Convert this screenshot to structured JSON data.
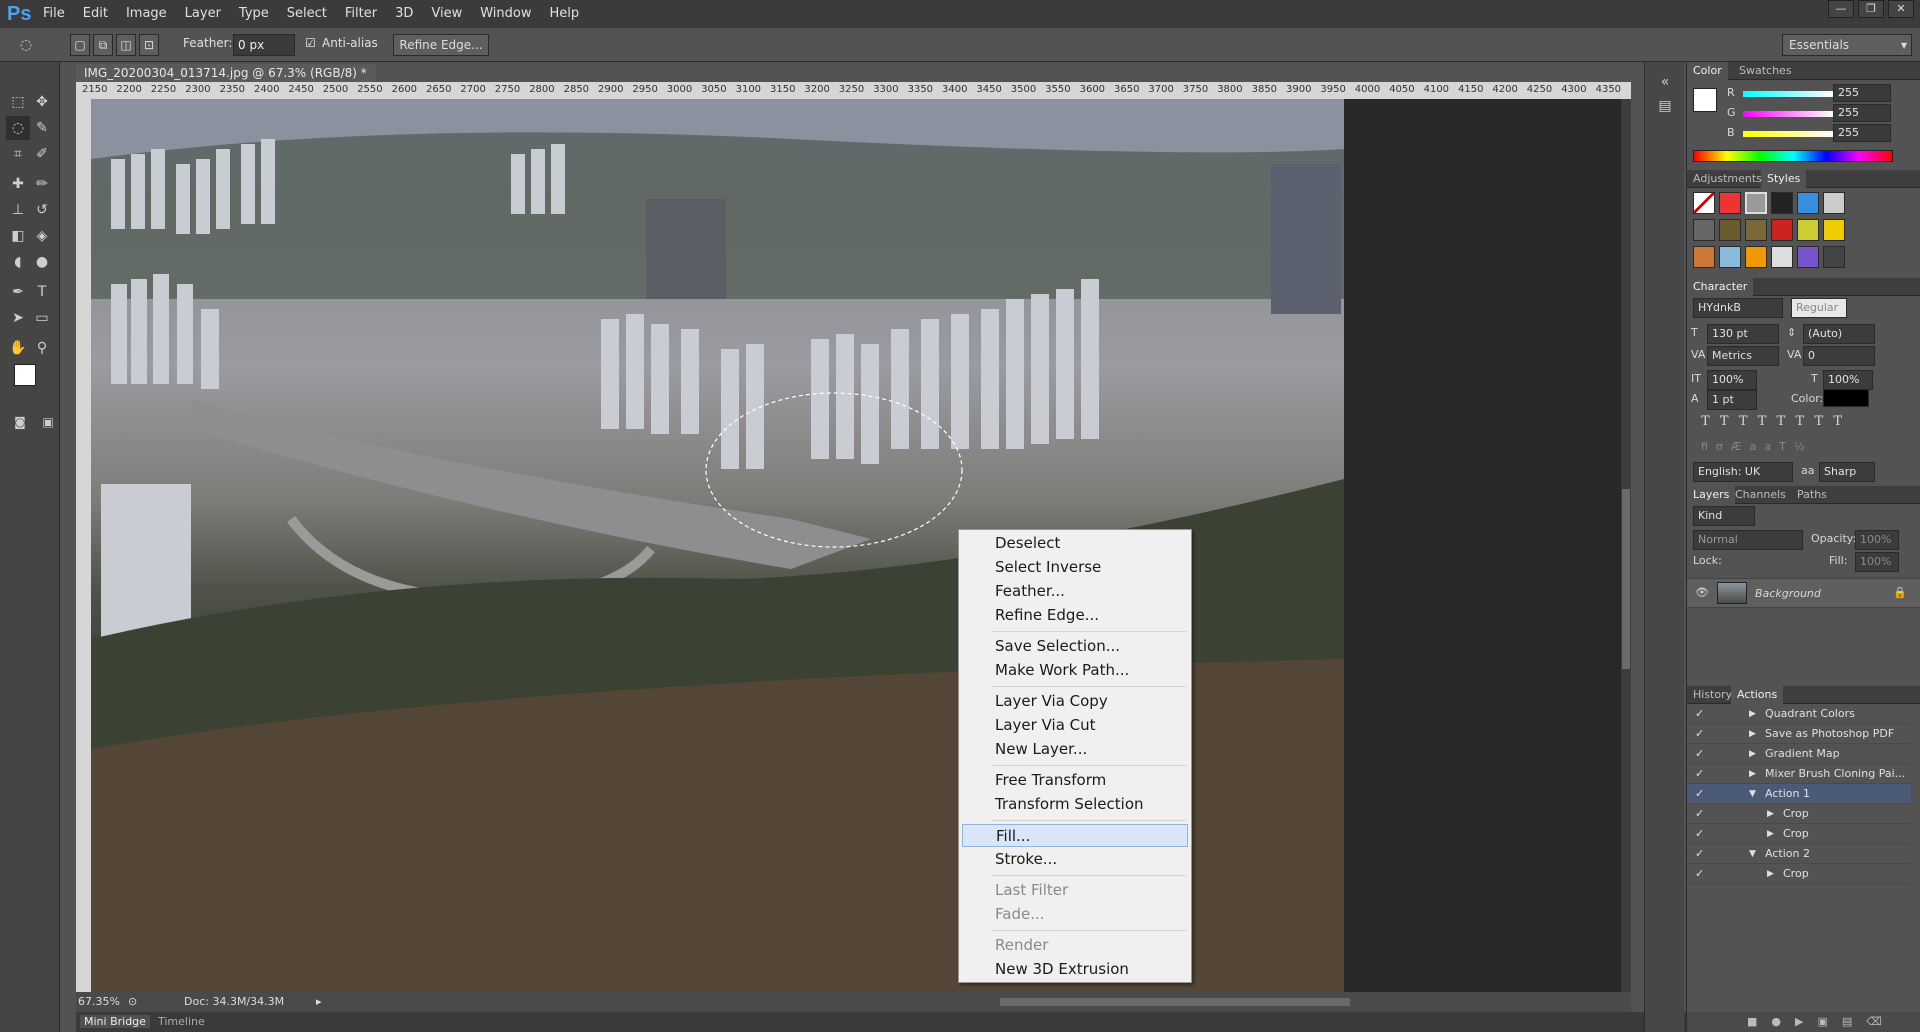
{
  "app": {
    "logo": "Ps"
  },
  "menubar": {
    "items": [
      "File",
      "Edit",
      "Image",
      "Layer",
      "Type",
      "Select",
      "Filter",
      "3D",
      "View",
      "Window",
      "Help"
    ]
  },
  "window_controls": {
    "minimize": "—",
    "restore": "❐",
    "close": "✕"
  },
  "options": {
    "feather_label": "Feather:",
    "feather_value": "0 px",
    "antialias_label": "Anti-alias",
    "antialias_checked": true,
    "refine_edge": "Refine Edge...",
    "workspace": "Essentials"
  },
  "document": {
    "tab_title": "IMG_20200304_013714.jpg @ 67.3% (RGB/8) *",
    "close": "×",
    "ruler_ticks": [
      "2150",
      "2200",
      "2250",
      "2300",
      "2350",
      "2400",
      "2450",
      "2500",
      "2550",
      "2600",
      "2650",
      "2700",
      "2750",
      "2800",
      "2850",
      "2900",
      "2950",
      "3000",
      "3050",
      "3100",
      "3150",
      "3200",
      "3250",
      "3300",
      "3350",
      "3400",
      "3450",
      "3500",
      "3550",
      "3600",
      "3650",
      "3700",
      "3750",
      "3800",
      "3850",
      "3900",
      "3950",
      "4000",
      "4050",
      "4100",
      "4150",
      "4200",
      "4250",
      "4300",
      "4350"
    ]
  },
  "status": {
    "zoom": "67.35%",
    "doc": "Doc: 34.3M/34.3M"
  },
  "bottom_tabs": [
    "Mini Bridge",
    "Timeline"
  ],
  "context_menu": {
    "items": [
      {
        "label": "Deselect",
        "state": "normal"
      },
      {
        "label": "Select Inverse",
        "state": "normal"
      },
      {
        "label": "Feather...",
        "state": "normal"
      },
      {
        "label": "Refine Edge...",
        "state": "normal"
      },
      {
        "label": "Save Selection...",
        "state": "normal"
      },
      {
        "label": "Make Work Path...",
        "state": "normal"
      },
      {
        "label": "Layer Via Copy",
        "state": "normal"
      },
      {
        "label": "Layer Via Cut",
        "state": "normal"
      },
      {
        "label": "New Layer...",
        "state": "normal"
      },
      {
        "label": "Free Transform",
        "state": "normal"
      },
      {
        "label": "Transform Selection",
        "state": "normal"
      },
      {
        "label": "Fill...",
        "state": "highlighted"
      },
      {
        "label": "Stroke...",
        "state": "normal"
      },
      {
        "label": "Last Filter",
        "state": "disabled"
      },
      {
        "label": "Fade...",
        "state": "disabled"
      },
      {
        "label": "Render",
        "state": "disabled"
      },
      {
        "label": "New 3D Extrusion",
        "state": "normal"
      }
    ]
  },
  "color_panel": {
    "tabs": [
      "Color",
      "Swatches"
    ],
    "r_label": "R",
    "g_label": "G",
    "b_label": "B",
    "r": "255",
    "g": "255",
    "b": "255"
  },
  "styles_panel": {
    "tabs": [
      "Adjustments",
      "Styles"
    ]
  },
  "character_panel": {
    "title": "Character",
    "font": "HYdnkB",
    "style": "Regular",
    "size": "130 pt",
    "leading": "(Auto)",
    "kerning": "Metrics",
    "tracking": "0",
    "vscale": "100%",
    "hscale": "100%",
    "baseline": "1 pt",
    "color_label": "Color:",
    "language": "English: UK",
    "aa": "Sharp",
    "aa_prefix": "aa"
  },
  "layers_panel": {
    "tabs": [
      "Layers",
      "Channels",
      "Paths"
    ],
    "kind": "Kind",
    "blend": "Normal",
    "opacity_label": "Opacity:",
    "opacity": "100%",
    "lock_label": "Lock:",
    "fill_label": "Fill:",
    "fill": "100%",
    "layer_name": "Background"
  },
  "actions_panel": {
    "tabs": [
      "History",
      "Actions"
    ],
    "rows": [
      {
        "name": "Quadrant Colors",
        "indent": 0,
        "open": false
      },
      {
        "name": "Save as Photoshop PDF",
        "indent": 0,
        "open": false
      },
      {
        "name": "Gradient Map",
        "indent": 0,
        "open": false
      },
      {
        "name": "Mixer Brush Cloning Pai...",
        "indent": 0,
        "open": false
      },
      {
        "name": "Action 1",
        "indent": 0,
        "open": true
      },
      {
        "name": "Crop",
        "indent": 1,
        "open": false
      },
      {
        "name": "Crop",
        "indent": 1,
        "open": false
      },
      {
        "name": "Action 2",
        "indent": 0,
        "open": true
      },
      {
        "name": "Crop",
        "indent": 1,
        "open": false
      }
    ]
  }
}
